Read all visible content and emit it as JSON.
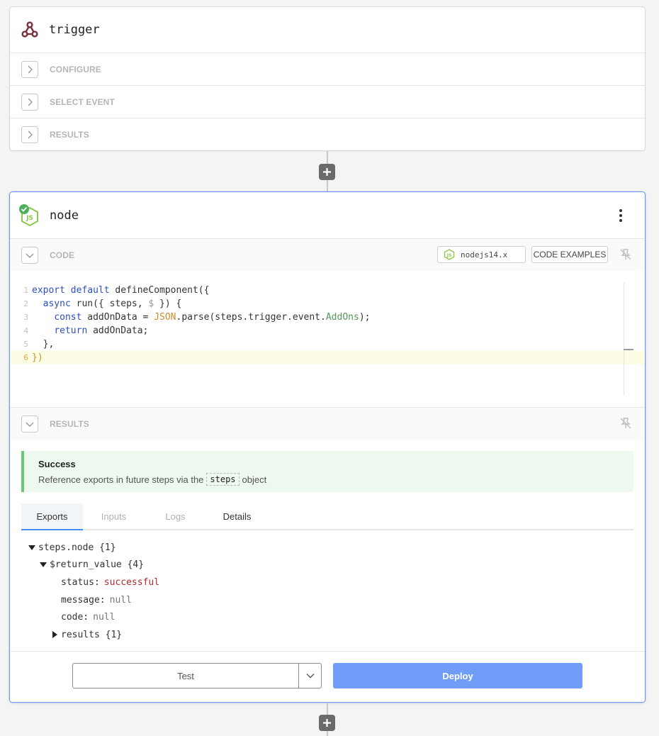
{
  "trigger": {
    "title": "trigger",
    "icon": "webhook-icon",
    "sections": [
      "CONFIGURE",
      "SELECT EVENT",
      "RESULTS"
    ]
  },
  "node": {
    "title": "node",
    "icon": "nodejs-icon",
    "status": "success",
    "code_section": {
      "label": "CODE",
      "runtime": "nodejs14.x",
      "examples_label": "CODE EXAMPLES"
    },
    "code_lines": [
      "export default defineComponent({",
      "  async run({ steps, $ }) {",
      "    const addOnData = JSON.parse(steps.trigger.event.AddOns);",
      "    return addOnData;",
      "  },",
      "})"
    ],
    "results_section": {
      "label": "RESULTS",
      "success_title": "Success",
      "success_prefix": "Reference exports in future steps via the",
      "success_chip": "steps",
      "success_suffix": "object"
    },
    "tabs": [
      "Exports",
      "Inputs",
      "Logs",
      "Details"
    ],
    "active_tab": "Exports",
    "tree": {
      "root": "steps.node {1}",
      "child": "$return_value {4}",
      "status_key": "status:",
      "status_val": "successful",
      "message_key": "message:",
      "message_val": "null",
      "code_key": "code:",
      "code_val": "null",
      "results": "results {1}"
    },
    "footer": {
      "test_label": "Test",
      "deploy_label": "Deploy"
    }
  },
  "colors": {
    "accent": "#6f9df7",
    "success": "#6cc77c",
    "node_green": "#8cc84b"
  }
}
